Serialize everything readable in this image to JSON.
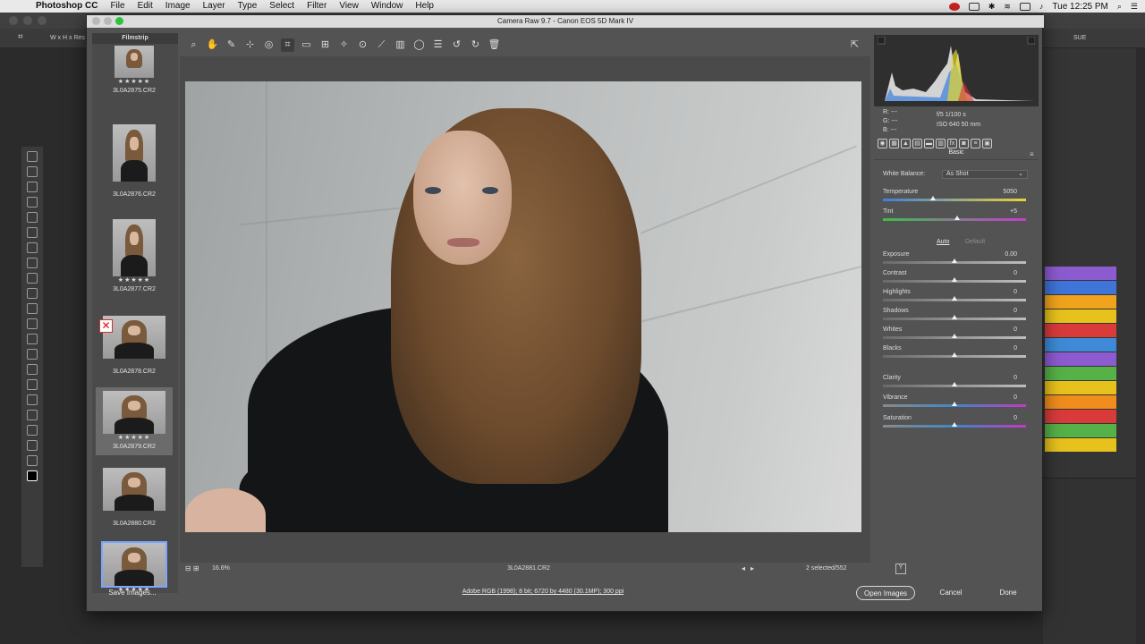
{
  "menubar": {
    "app": "Photoshop CC",
    "items": [
      "File",
      "Edit",
      "Image",
      "Layer",
      "Type",
      "Select",
      "Filter",
      "View",
      "Window",
      "Help"
    ],
    "clock": "Tue 12:25 PM"
  },
  "ps_options": {
    "size_field": "W x H x Res"
  },
  "ps_right": {
    "field": "SUE"
  },
  "dialog": {
    "title": "Camera Raw 9.7  -  Canon EOS 5D Mark IV"
  },
  "filmstrip": {
    "header": "Filmstrip",
    "thumbs": [
      {
        "name": "3L0A2875.CR2",
        "stars": "★★★★★"
      },
      {
        "name": "3L0A2876.CR2",
        "stars": ""
      },
      {
        "name": "3L0A2877.CR2",
        "stars": "★★★★★"
      },
      {
        "name": "3L0A2878.CR2",
        "stars": ""
      },
      {
        "name": "3L0A2879.CR2",
        "stars": "★★★★★"
      },
      {
        "name": "3L0A2880.CR2",
        "stars": ""
      },
      {
        "name": "",
        "stars": "★★★★★"
      }
    ]
  },
  "preview": {
    "zoom": "16.6%",
    "filename": "3L0A2881.CR2",
    "selection": "2 selected/552"
  },
  "readout": {
    "r": "R:  ---",
    "g": "G:  ---",
    "b": "B:  ---",
    "aperture_shutter": "f/5    1/100 s",
    "iso_focal": "ISO 640    50 mm"
  },
  "panel": {
    "title": "Basic",
    "white_balance_label": "White Balance:",
    "white_balance_value": "As Shot",
    "auto": "Auto",
    "default": "Default",
    "sliders": [
      {
        "label": "Temperature",
        "value": "5050",
        "pos": 0.35
      },
      {
        "label": "Tint",
        "value": "+5",
        "pos": 0.52
      },
      {
        "label": "Exposure",
        "value": "0.00",
        "pos": 0.5
      },
      {
        "label": "Contrast",
        "value": "0",
        "pos": 0.5
      },
      {
        "label": "Highlights",
        "value": "0",
        "pos": 0.5
      },
      {
        "label": "Shadows",
        "value": "0",
        "pos": 0.5
      },
      {
        "label": "Whites",
        "value": "0",
        "pos": 0.5
      },
      {
        "label": "Blacks",
        "value": "0",
        "pos": 0.5
      },
      {
        "label": "Clarity",
        "value": "0",
        "pos": 0.5
      },
      {
        "label": "Vibrance",
        "value": "0",
        "pos": 0.5
      },
      {
        "label": "Saturation",
        "value": "0",
        "pos": 0.5
      }
    ]
  },
  "bottom": {
    "save": "Save Images...",
    "workflow": "Adobe RGB (1998); 8 bit; 6720 by 4480 (30.1MP); 300 ppi",
    "open": "Open Images",
    "cancel": "Cancel",
    "done": "Done"
  },
  "colors": {
    "swatches": [
      "#8d5bd0",
      "#3f74d8",
      "#f1a31d",
      "#e7c21d",
      "#d93b3b",
      "#3e8ad6",
      "#8d5bd0",
      "#55b148",
      "#e7c21d",
      "#f08d1c",
      "#d93b3b",
      "#55b148",
      "#e7c21d"
    ]
  }
}
